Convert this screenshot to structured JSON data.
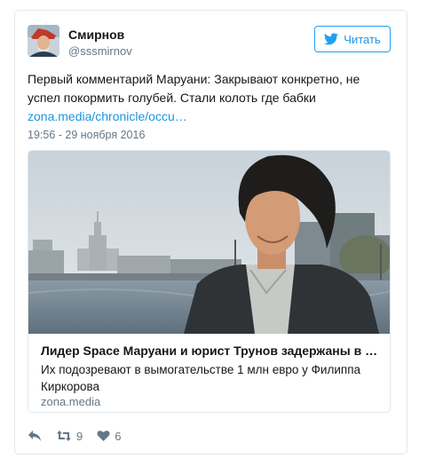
{
  "author": {
    "name": "Смирнов",
    "handle": "@sssmirnov",
    "avatar_icon": "user-avatar"
  },
  "follow_button": {
    "label": "Читать",
    "icon": "twitter-bird-icon",
    "color": "#1da1f2"
  },
  "tweet": {
    "text": "Первый комментарий Маруани: Закрывают конкретно, не успел покормить голубей. Стали колоть где бабки",
    "link": "zona.media/chronicle/occu…",
    "timestamp": "19:56 - 29 ноября 2016"
  },
  "card": {
    "image_icon": "news-photo",
    "title": "Лидер Space Маруани и юрист Трунов задержаны в Мо…",
    "description": "Их подозревают в вымогательстве 1 млн евро у Филиппа Киркорова",
    "domain": "zona.media"
  },
  "actions": {
    "reply_icon": "reply-icon",
    "retweet_icon": "retweet-icon",
    "retweet_count": "9",
    "like_icon": "heart-icon",
    "like_count": "6"
  },
  "colors": {
    "accent": "#1da1f2",
    "link": "#1b95e0",
    "muted": "#657786",
    "border": "#e1e8ed"
  }
}
